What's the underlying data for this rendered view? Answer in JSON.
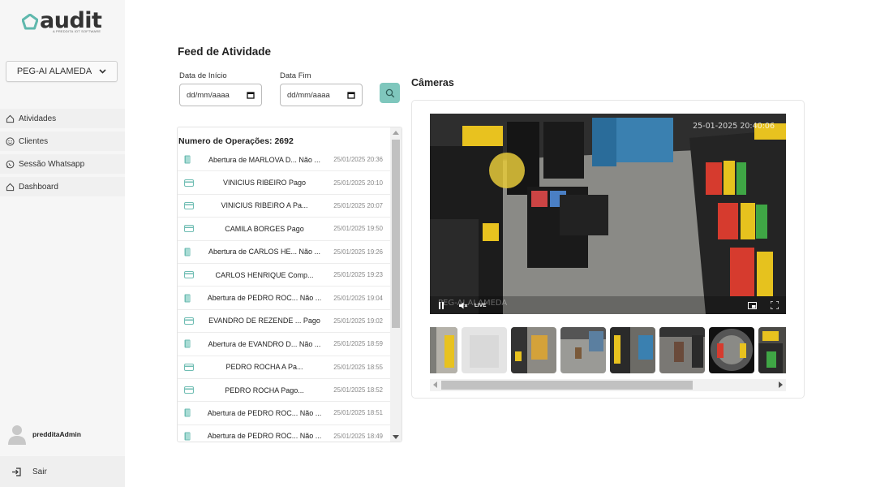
{
  "app": {
    "logo_text": "audit",
    "logo_subtitle": "A PREDDITA IOT SOFTWARE"
  },
  "sidebar": {
    "store": "PEG-AI ALAMEDA",
    "items": [
      {
        "label": "Atividades",
        "icon": "home-icon"
      },
      {
        "label": "Clientes",
        "icon": "smiley-icon"
      },
      {
        "label": "Sessão Whatsapp",
        "icon": "whatsapp-icon"
      },
      {
        "label": "Dashboard",
        "icon": "home-icon"
      }
    ],
    "user": "predditaAdmin",
    "logout": "Sair"
  },
  "feed": {
    "title": "Feed de Atividade",
    "start_label": "Data de Início",
    "end_label": "Data Fim",
    "start_placeholder": "dd/mm/aaaa",
    "end_placeholder": "dd/mm/aaaa",
    "ops_count": "Numero de Operações: 2692",
    "rows": [
      {
        "type": "door",
        "text": "Abertura de MARLOVA D... Não ...",
        "time": "25/01/2025 20:36"
      },
      {
        "type": "card",
        "text": "VINICIUS RIBEIRO Pago",
        "time": "25/01/2025 20:10"
      },
      {
        "type": "card",
        "text": "VINICIUS RIBEIRO A Pa...",
        "time": "25/01/2025 20:07"
      },
      {
        "type": "card",
        "text": "CAMILA BORGES Pago",
        "time": "25/01/2025 19:50"
      },
      {
        "type": "door",
        "text": "Abertura de CARLOS HE... Não ...",
        "time": "25/01/2025 19:26"
      },
      {
        "type": "card",
        "text": "CARLOS HENRIQUE Comp...",
        "time": "25/01/2025 19:23"
      },
      {
        "type": "door",
        "text": "Abertura de PEDRO ROC... Não ...",
        "time": "25/01/2025 19:04"
      },
      {
        "type": "card",
        "text": "EVANDRO DE REZENDE ... Pago",
        "time": "25/01/2025 19:02"
      },
      {
        "type": "door",
        "text": "Abertura de EVANDRO D... Não ...",
        "time": "25/01/2025 18:59"
      },
      {
        "type": "card",
        "text": "PEDRO ROCHA A Pa...",
        "time": "25/01/2025 18:55"
      },
      {
        "type": "card",
        "text": "PEDRO ROCHA Pago...",
        "time": "25/01/2025 18:52"
      },
      {
        "type": "door",
        "text": "Abertura de PEDRO ROC... Não ...",
        "time": "25/01/2025 18:51"
      },
      {
        "type": "door",
        "text": "Abertura de PEDRO ROC... Não ...",
        "time": "25/01/2025 18:49"
      }
    ]
  },
  "cameras": {
    "title": "Câmeras",
    "timestamp": "25-01-2025 20:40:06",
    "camera_name": "PEG-AI ALAMEDA",
    "live_label": "LIVE"
  },
  "colors": {
    "accent": "#7fc7bd",
    "icon_teal": "#6fbdb3"
  }
}
